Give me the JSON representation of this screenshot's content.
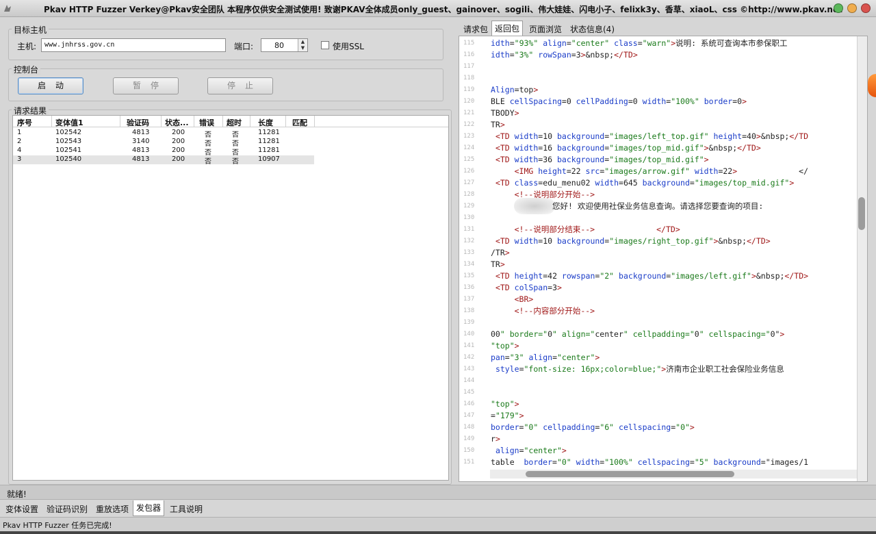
{
  "window": {
    "title": "Pkav HTTP Fuzzer  Verkey@Pkav安全团队  本程序仅供安全测试使用! 致谢PKAV全体成员only_guest、gainover、sogili、伟大娃娃、闪电小子、felixk3y、香草、xiaoL、css ©http://www.pkav.net",
    "controls": {
      "minimize_color": "#5cb85c",
      "maximize_color": "#f0ad4e",
      "close_color": "#d9534f"
    }
  },
  "target": {
    "group_title": "目标主机",
    "host_label": "主机:",
    "host_value": "www.jnhrss.gov.cn",
    "port_label": "端口:",
    "port_value": "80",
    "ssl_label": "使用SSL"
  },
  "console": {
    "group_title": "控制台",
    "start_label": "启动",
    "pause_label": "暂停",
    "stop_label": "停止"
  },
  "results": {
    "group_title": "请求结果",
    "columns": [
      "序号",
      "变体值1",
      "验证码",
      "状态...",
      "错误",
      "超时",
      "长度",
      "匹配"
    ],
    "rows": [
      {
        "seq": "1",
        "v1": "102542",
        "code": "4813",
        "status": "200",
        "error": "否",
        "timeout": "否",
        "length": "11281",
        "match": ""
      },
      {
        "seq": "2",
        "v1": "102543",
        "code": "3140",
        "status": "200",
        "error": "否",
        "timeout": "否",
        "length": "11281",
        "match": ""
      },
      {
        "seq": "4",
        "v1": "102541",
        "code": "4813",
        "status": "200",
        "error": "否",
        "timeout": "否",
        "length": "11281",
        "match": ""
      },
      {
        "seq": "3",
        "v1": "102540",
        "code": "4813",
        "status": "200",
        "error": "否",
        "timeout": "否",
        "length": "10907",
        "match": ""
      }
    ],
    "selected_index": 3
  },
  "right_tabs": [
    {
      "label": "请求包"
    },
    {
      "label": "返回包"
    },
    {
      "label": "页面浏览"
    },
    {
      "label": "状态信息(4)"
    }
  ],
  "active_right_tab": 1,
  "code_lines": [
    {
      "n": "115",
      "t": "idth=\"93%\" align=\"center\" class=\"warn\">说明: 系统可查询本市参保职工"
    },
    {
      "n": "116",
      "t": "idth=\"3%\" rowSpan=3>&nbsp;</TD>"
    },
    {
      "n": "117",
      "t": ""
    },
    {
      "n": "118",
      "t": ""
    },
    {
      "n": "119",
      "t": "Align=top>"
    },
    {
      "n": "120",
      "t": "BLE cellSpacing=0 cellPadding=0 width=\"100%\" border=0>"
    },
    {
      "n": "121",
      "t": "TBODY>"
    },
    {
      "n": "122",
      "t": "TR>"
    },
    {
      "n": "123",
      "t": " <TD width=10 background=\"images/left_top.gif\" height=40>&nbsp;</TD"
    },
    {
      "n": "124",
      "t": " <TD width=16 background=\"images/top_mid.gif\">&nbsp;</TD>"
    },
    {
      "n": "125",
      "t": " <TD width=36 background=\"images/top_mid.gif\">"
    },
    {
      "n": "126",
      "t": "     <IMG height=22 src=\"images/arrow.gif\" width=22>             </"
    },
    {
      "n": "127",
      "t": " <TD class=edu_menu02 width=645 background=\"images/top_mid.gif\">"
    },
    {
      "n": "128",
      "t": "     <!--说明部分开始-->"
    },
    {
      "n": "129",
      "t": "             您好! 欢迎使用社保业务信息查询。请选择您要查询的项目:"
    },
    {
      "n": "130",
      "t": ""
    },
    {
      "n": "131",
      "t": "     <!--说明部分结束-->             </TD>"
    },
    {
      "n": "132",
      "t": " <TD width=10 background=\"images/right_top.gif\">&nbsp;</TD>"
    },
    {
      "n": "133",
      "t": "/TR>"
    },
    {
      "n": "134",
      "t": "TR>"
    },
    {
      "n": "135",
      "t": " <TD height=42 rowspan=\"2\" background=\"images/left.gif\">&nbsp;</TD>"
    },
    {
      "n": "136",
      "t": " <TD colSpan=3>"
    },
    {
      "n": "137",
      "t": "     <BR>"
    },
    {
      "n": "138",
      "t": "     <!--内容部分开始-->"
    },
    {
      "n": "139",
      "t": ""
    },
    {
      "n": "140",
      "t": "00\" border=\"0\" align=\"center\" cellpadding=\"0\" cellspacing=\"0\">"
    },
    {
      "n": "141",
      "t": "\"top\">"
    },
    {
      "n": "142",
      "t": "pan=\"3\" align=\"center\">"
    },
    {
      "n": "143",
      "t": " style=\"font-size: 16px;color=blue;\">济南市企业职工社会保险业务信息"
    },
    {
      "n": "144",
      "t": ""
    },
    {
      "n": "145",
      "t": ""
    },
    {
      "n": "146",
      "t": "\"top\">"
    },
    {
      "n": "147",
      "t": "=\"179\">"
    },
    {
      "n": "148",
      "t": "border=\"0\" cellpadding=\"6\" cellspacing=\"0\">"
    },
    {
      "n": "149",
      "t": "r>"
    },
    {
      "n": "150",
      "t": " align=\"center\">"
    },
    {
      "n": "151",
      "t": "table  border=\"0\" width=\"100%\" cellspacing=\"5\" background=\"images/1"
    }
  ],
  "status_bar": {
    "text": "就绪!"
  },
  "bottom_tabs": [
    {
      "label": "变体设置"
    },
    {
      "label": "验证码识别"
    },
    {
      "label": "重放选项"
    },
    {
      "label": "发包器"
    },
    {
      "label": "工具说明"
    }
  ],
  "active_bottom_tab": 3,
  "task_status": {
    "text": "Pkav HTTP Fuzzer 任务已完成!"
  },
  "syntax_colors": {
    "tag": "#a01818",
    "attr": "#1a3cc8",
    "value": "#1a7a1a",
    "text": "#222222"
  }
}
